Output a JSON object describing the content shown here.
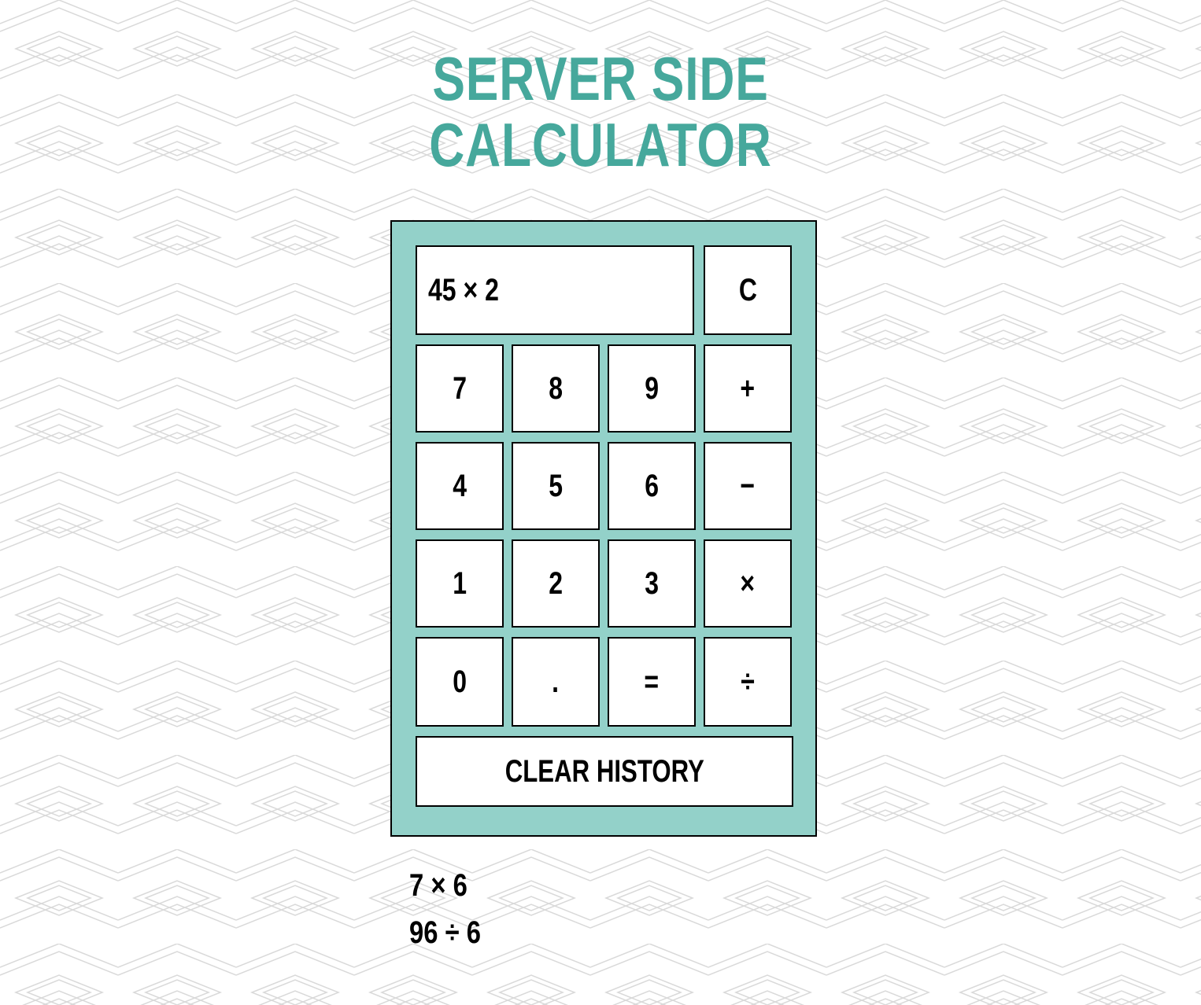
{
  "title": {
    "line1": "SERVER SIDE",
    "line2": "CALCULATOR"
  },
  "display": {
    "value": "45 × 2"
  },
  "keys": {
    "clear": "C",
    "seven": "7",
    "eight": "8",
    "nine": "9",
    "plus": "+",
    "four": "4",
    "five": "5",
    "six": "6",
    "minus": "−",
    "one": "1",
    "two": "2",
    "three": "3",
    "multiply": "×",
    "zero": "0",
    "decimal": ".",
    "equals": "=",
    "divide": "÷",
    "clear_history": "CLEAR HISTORY"
  },
  "history": [
    "7 × 6",
    "96 ÷ 6"
  ],
  "colors": {
    "title": "#46a89c",
    "calculator_background": "#93d1c9",
    "key_background": "#ffffff",
    "border": "#000000",
    "pattern_line": "#d9d9d9"
  }
}
